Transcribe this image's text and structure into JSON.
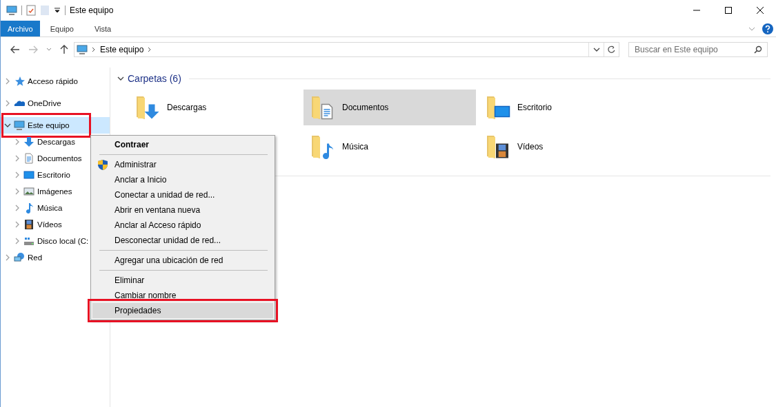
{
  "window": {
    "title": "Este equipo"
  },
  "ribbon_tabs": [
    {
      "label": "Archivo",
      "selected": true
    },
    {
      "label": "Equipo",
      "selected": false
    },
    {
      "label": "Vista",
      "selected": false
    }
  ],
  "address": {
    "path": "Este equipo"
  },
  "search": {
    "placeholder": "Buscar en Este equipo"
  },
  "sidebar": {
    "items": [
      {
        "label": "Acceso rápido",
        "expanded": false,
        "selected": false,
        "highlighted": false
      },
      {
        "label": "OneDrive",
        "expanded": false,
        "selected": false,
        "highlighted": false
      },
      {
        "label": "Este equipo",
        "expanded": true,
        "selected": true,
        "highlighted": true,
        "children": [
          {
            "label": "Descargas",
            "expanded": false,
            "selected": false,
            "highlighted": false
          },
          {
            "label": "Documentos",
            "expanded": false,
            "selected": false,
            "highlighted": false
          },
          {
            "label": "Escritorio",
            "expanded": false,
            "selected": false,
            "highlighted": false
          },
          {
            "label": "Imágenes",
            "expanded": false,
            "selected": false,
            "highlighted": false
          },
          {
            "label": "Música",
            "expanded": false,
            "selected": false,
            "highlighted": false
          },
          {
            "label": "Vídeos",
            "expanded": false,
            "selected": false,
            "highlighted": false
          },
          {
            "label": "Disco local (C:",
            "expanded": false,
            "selected": false,
            "highlighted": false
          }
        ]
      },
      {
        "label": "Red",
        "expanded": false,
        "selected": false,
        "highlighted": false
      }
    ]
  },
  "section": {
    "title": "Carpetas (6)",
    "expanded": true
  },
  "folders": [
    {
      "name": "Descargas",
      "selected": false
    },
    {
      "name": "Documentos",
      "selected": true
    },
    {
      "name": "Escritorio",
      "selected": false
    },
    {
      "name": "Música",
      "selected": false
    },
    {
      "name": "Vídeos",
      "selected": false
    }
  ],
  "context_menu": {
    "groups": [
      [
        {
          "label": "Contraer",
          "kind": "default",
          "selected": false,
          "highlighted": false
        }
      ],
      [
        {
          "label": "Administrar",
          "kind": "shield",
          "selected": false,
          "highlighted": false
        },
        {
          "label": "Anclar a Inicio",
          "kind": "plain",
          "selected": false,
          "highlighted": false
        },
        {
          "label": "Conectar a unidad de red...",
          "kind": "plain",
          "selected": false,
          "highlighted": false
        },
        {
          "label": "Abrir en ventana nueva",
          "kind": "plain",
          "selected": false,
          "highlighted": false
        },
        {
          "label": "Anclar al Acceso rápido",
          "kind": "plain",
          "selected": false,
          "highlighted": false
        },
        {
          "label": "Desconectar unidad de red...",
          "kind": "plain",
          "selected": false,
          "highlighted": false
        }
      ],
      [
        {
          "label": "Agregar una ubicación de red",
          "kind": "plain",
          "selected": false,
          "highlighted": false
        }
      ],
      [
        {
          "label": "Eliminar",
          "kind": "plain",
          "selected": false,
          "highlighted": false
        },
        {
          "label": "Cambiar nombre",
          "kind": "plain",
          "selected": false,
          "highlighted": false
        },
        {
          "label": "Propiedades",
          "kind": "plain",
          "selected": true,
          "highlighted": true
        }
      ]
    ]
  }
}
